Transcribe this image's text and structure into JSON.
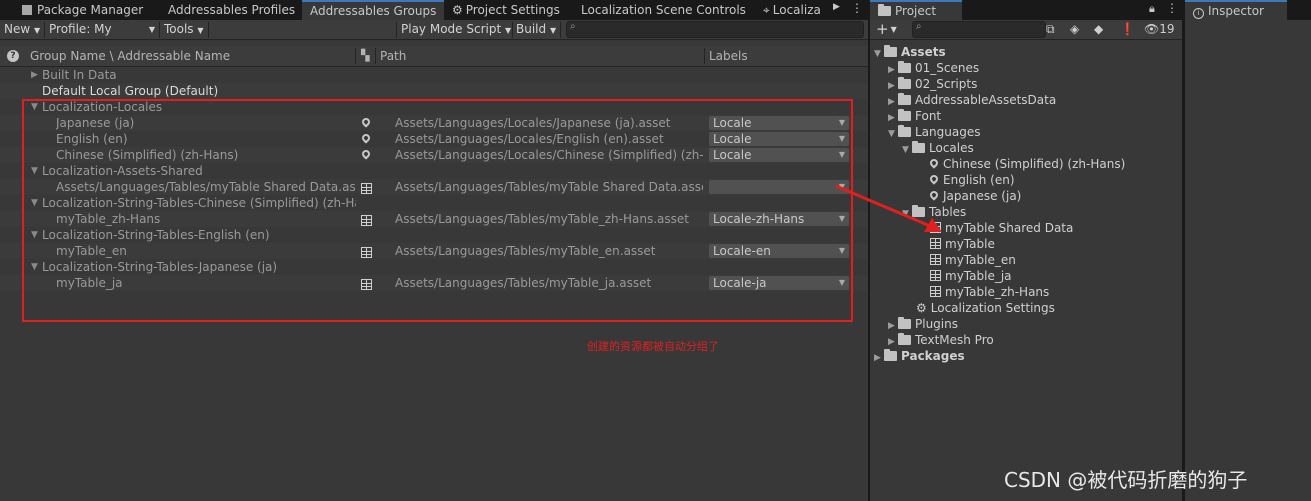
{
  "tabs": {
    "package_manager": "Package Manager",
    "addressables_profiles": "Addressables Profiles",
    "addressables_groups": "Addressables Groups",
    "project_settings": "Project Settings",
    "localization_scene_controls": "Localization Scene Controls",
    "localiza": "Localiza",
    "project": "Project",
    "inspector": "Inspector"
  },
  "toolbar": {
    "new": "New",
    "profile": "Profile: My",
    "tools": "Tools",
    "play_mode_script": "Play Mode Script",
    "build": "Build"
  },
  "columns": {
    "group_name": "Group Name \\ Addressable Name",
    "path": "Path",
    "labels": "Labels"
  },
  "groups": {
    "built_in": "Built In Data",
    "default_local": "Default Local Group (Default)",
    "locales_group": "Localization-Locales",
    "locales": [
      {
        "name": "Japanese (ja)",
        "path": "Assets/Languages/Locales/Japanese (ja).asset",
        "label": "Locale"
      },
      {
        "name": "English (en)",
        "path": "Assets/Languages/Locales/English (en).asset",
        "label": "Locale"
      },
      {
        "name": "Chinese (Simplified) (zh-Hans)",
        "path": "Assets/Languages/Locales/Chinese (Simplified) (zh-Ha",
        "label": "Locale"
      }
    ],
    "assets_shared_group": "Localization-Assets-Shared",
    "shared": {
      "name": "Assets/Languages/Tables/myTable Shared Data.asse",
      "path": "Assets/Languages/Tables/myTable Shared Data.asset",
      "label": ""
    },
    "zh_group": "Localization-String-Tables-Chinese (Simplified) (zh-Ha",
    "zh": {
      "name": "myTable_zh-Hans",
      "path": "Assets/Languages/Tables/myTable_zh-Hans.asset",
      "label": "Locale-zh-Hans"
    },
    "en_group": "Localization-String-Tables-English (en)",
    "en": {
      "name": "myTable_en",
      "path": "Assets/Languages/Tables/myTable_en.asset",
      "label": "Locale-en"
    },
    "ja_group": "Localization-String-Tables-Japanese (ja)",
    "ja": {
      "name": "myTable_ja",
      "path": "Assets/Languages/Tables/myTable_ja.asset",
      "label": "Locale-ja"
    }
  },
  "annotation": {
    "text": "创建的资源都被自动分组了",
    "color": "#e02020"
  },
  "project": {
    "badge_count": "19",
    "assets": "Assets",
    "scenes": "01_Scenes",
    "scripts": "02_Scripts",
    "addressable_data": "AddressableAssetsData",
    "font": "Font",
    "languages": "Languages",
    "locales": "Locales",
    "locale_zh": "Chinese (Simplified) (zh-Hans)",
    "locale_en": "English (en)",
    "locale_ja": "Japanese (ja)",
    "tables": "Tables",
    "shared_data": "myTable Shared Data",
    "mytable": "myTable",
    "mytable_en": "myTable_en",
    "mytable_ja": "myTable_ja",
    "mytable_zh": "myTable_zh-Hans",
    "loc_settings": "Localization Settings",
    "plugins": "Plugins",
    "textmesh": "TextMesh Pro",
    "packages": "Packages"
  },
  "watermark": "CSDN @被代码折磨的狗子",
  "colors": {
    "accent": "#3a79bb",
    "annotation_red": "#e02020"
  }
}
